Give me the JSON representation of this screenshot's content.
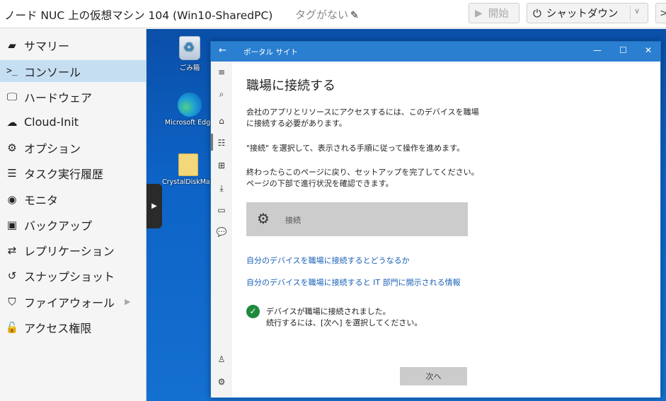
{
  "topbar": {
    "title": "ノード NUC 上の仮想マシン 104 (Win10-SharedPC)",
    "tags": "タグがない",
    "start_label": "開始",
    "shutdown_label": "シャットダウン"
  },
  "sidebar": {
    "items": [
      {
        "label": "サマリー",
        "icon": "book-icon"
      },
      {
        "label": "コンソール",
        "icon": "terminal-icon",
        "active": true
      },
      {
        "label": "ハードウェア",
        "icon": "monitor-icon"
      },
      {
        "label": "Cloud-Init",
        "icon": "cloud-icon"
      },
      {
        "label": "オプション",
        "icon": "gear-icon"
      },
      {
        "label": "タスク実行履歴",
        "icon": "list-icon"
      },
      {
        "label": "モニタ",
        "icon": "eye-icon"
      },
      {
        "label": "バックアップ",
        "icon": "floppy-icon"
      },
      {
        "label": "レプリケーション",
        "icon": "retweet-icon"
      },
      {
        "label": "スナップショット",
        "icon": "history-icon"
      },
      {
        "label": "ファイアウォール",
        "icon": "shield-icon",
        "has_submenu": true
      },
      {
        "label": "アクセス権限",
        "icon": "unlock-icon"
      }
    ]
  },
  "desktop": {
    "icons": [
      {
        "label": "ごみ箱",
        "icon": "recycle-bin-icon"
      },
      {
        "label": "Microsoft Edge",
        "icon": "edge-icon"
      },
      {
        "label": "CrystalDiskMark",
        "icon": "folder-icon"
      }
    ]
  },
  "window": {
    "title": "ポータル サイト",
    "heading": "職場に接続する",
    "para1": "会社のアプリとリソースにアクセスするには、このデバイスを職場に接続する必要があります。",
    "para2": "\"接続\" を選択して、表示される手順に従って操作を進めます。",
    "para3": "終わったらこのページに戻り、セットアップを完了してください。ページの下部で進行状況を確認できます。",
    "connect_label": "接続",
    "link1": "自分のデバイスを職場に接続するとどうなるか",
    "link2": "自分のデバイスを職場に接続すると IT 部門に開示される情報",
    "status_line1": "デバイスが職場に接続されました。",
    "status_line2": "続行するには、[次へ] を選択してください。",
    "next_label": "次へ"
  },
  "colors": {
    "active_nav": "#c5def2",
    "title_bar": "#2a7fd0",
    "link": "#1a62b8",
    "success": "#1e8a3c"
  }
}
